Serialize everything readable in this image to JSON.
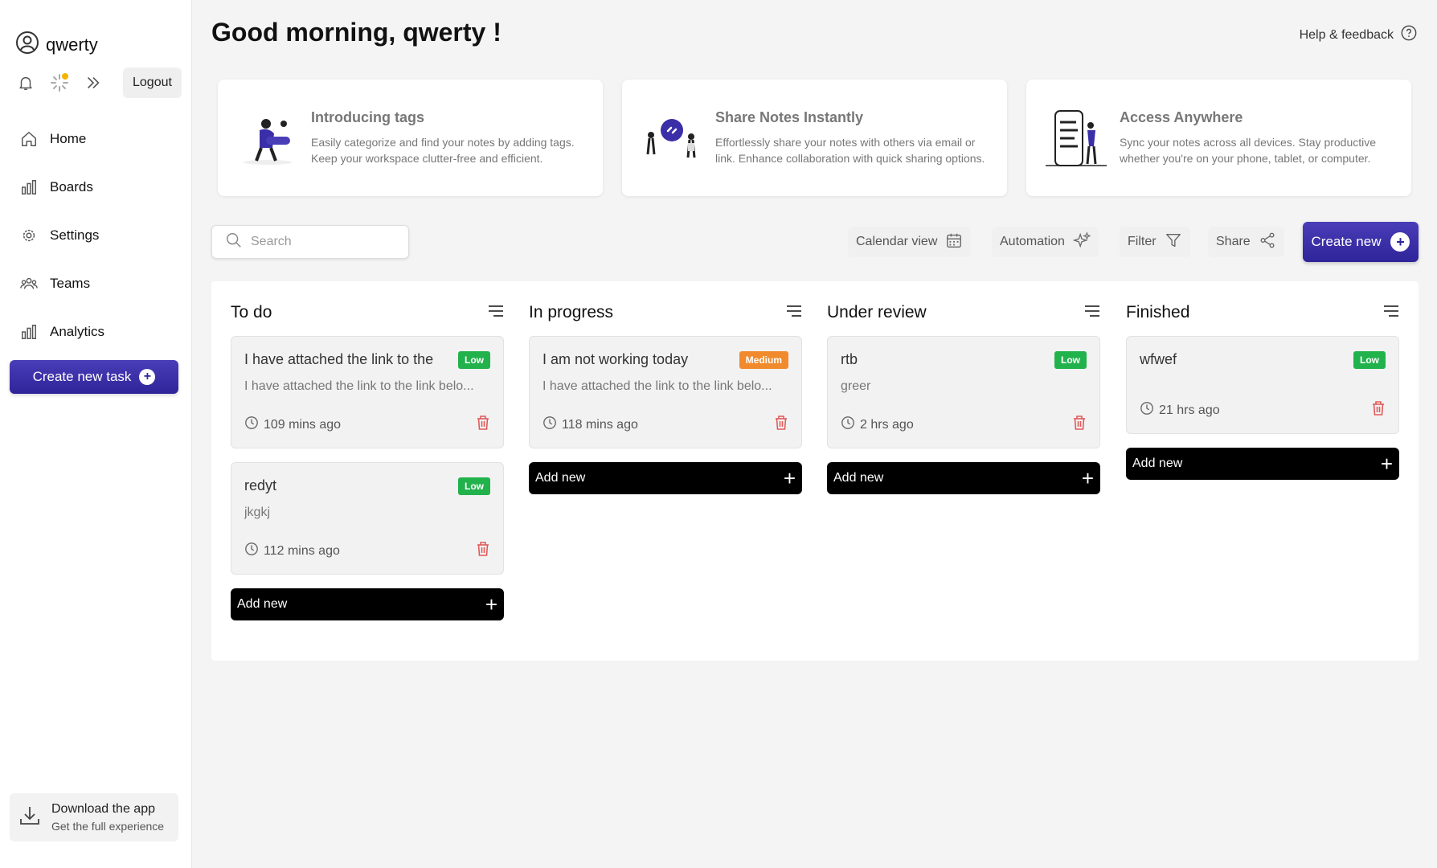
{
  "user": {
    "name": "qwerty"
  },
  "sidebar": {
    "logout_label": "Logout",
    "items": [
      {
        "label": "Home",
        "icon": "home-icon"
      },
      {
        "label": "Boards",
        "icon": "bar-chart-icon"
      },
      {
        "label": "Settings",
        "icon": "gear-icon"
      },
      {
        "label": "Teams",
        "icon": "people-icon"
      },
      {
        "label": "Analytics",
        "icon": "analytics-icon"
      }
    ],
    "create_task_label": "Create new task",
    "download": {
      "title": "Download the app",
      "subtitle": "Get the full experience"
    }
  },
  "header": {
    "greeting": "Good morning, qwerty !",
    "help_label": "Help & feedback"
  },
  "info_cards": [
    {
      "title": "Introducing tags",
      "text": "Easily categorize and find your notes by adding tags. Keep your workspace clutter-free and efficient."
    },
    {
      "title": "Share Notes Instantly",
      "text": "Effortlessly share your notes with others via email or link. Enhance collaboration with quick sharing options."
    },
    {
      "title": "Access Anywhere",
      "text": "Sync your notes across all devices. Stay productive whether you're on your phone, tablet, or computer."
    }
  ],
  "toolbar": {
    "search_placeholder": "Search",
    "calendar_label": "Calendar view",
    "automation_label": "Automation",
    "filter_label": "Filter",
    "share_label": "Share",
    "create_new_label": "Create new"
  },
  "colors": {
    "accent": "#3a2fa8",
    "low": "#22b24c",
    "medium": "#f08a2c",
    "trash": "#e05a5a"
  },
  "columns": [
    {
      "title": "To do",
      "tasks": [
        {
          "title": "I have attached the link to the",
          "desc": "I have attached the link to the link belo...",
          "priority": "Low",
          "time": "109 mins ago"
        },
        {
          "title": "redyt",
          "desc": "jkgkj",
          "priority": "Low",
          "time": "112 mins ago"
        }
      ],
      "add_label": "Add new"
    },
    {
      "title": "In progress",
      "tasks": [
        {
          "title": "I am not working today",
          "desc": "I have attached the link to the link belo...",
          "priority": "Medium",
          "time": "118 mins ago"
        }
      ],
      "add_label": "Add new"
    },
    {
      "title": "Under review",
      "tasks": [
        {
          "title": "rtb",
          "desc": "greer",
          "priority": "Low",
          "time": "2 hrs ago"
        }
      ],
      "add_label": "Add new"
    },
    {
      "title": "Finished",
      "tasks": [
        {
          "title": "wfwef",
          "desc": "",
          "priority": "Low",
          "time": "21 hrs ago"
        }
      ],
      "add_label": "Add new"
    }
  ]
}
